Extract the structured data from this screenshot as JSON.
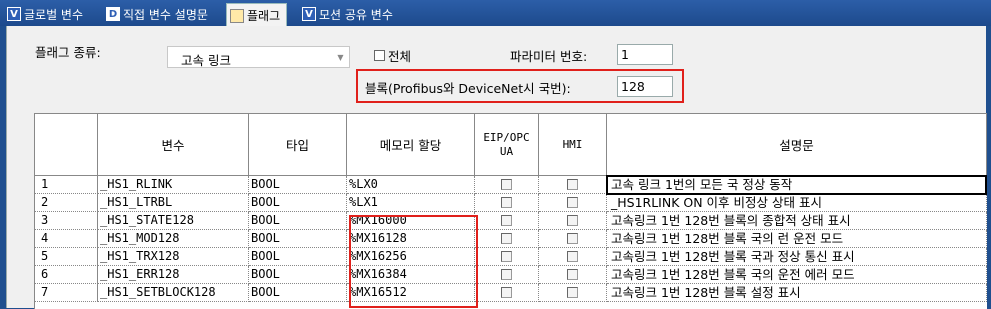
{
  "tabs": [
    {
      "icon": "V",
      "label": "글로벌 변수",
      "active": false
    },
    {
      "icon": "D",
      "label": "직접 변수 설명문",
      "active": false
    },
    {
      "icon": "F",
      "label": "플래그",
      "active": true
    },
    {
      "icon": "V",
      "label": "모션 공유 변수",
      "active": false
    }
  ],
  "filter": {
    "flag_type_label": "플래그 종류:",
    "flag_type_value": "고속 링크",
    "all_label": "전체",
    "param_label": "파라미터 번호:",
    "param_value": "1",
    "block_label": "블록(Profibus와 DeviceNet시 국번):",
    "block_value": "128"
  },
  "table": {
    "headers": [
      "변수",
      "타입",
      "메모리 할당",
      "EIP/OPC UA",
      "HMI",
      "설명문"
    ],
    "rows": [
      {
        "no": "1",
        "var": "_HS1_RLINK",
        "type": "BOOL",
        "mem": "%LX0",
        "desc": "고속 링크 1번의 모든 국 정상 동작"
      },
      {
        "no": "2",
        "var": "_HS1_LTRBL",
        "type": "BOOL",
        "mem": "%LX1",
        "desc": "_HS1RLINK ON 이후 비정상 상태 표시"
      },
      {
        "no": "3",
        "var": "_HS1_STATE128",
        "type": "BOOL",
        "mem": "%MX16000",
        "desc": "고속링크 1번 128번 블록의 종합적 상태 표시"
      },
      {
        "no": "4",
        "var": "_HS1_MOD128",
        "type": "BOOL",
        "mem": "%MX16128",
        "desc": "고속링크 1번 128번 블록 국의 런 운전 모드"
      },
      {
        "no": "5",
        "var": "_HS1_TRX128",
        "type": "BOOL",
        "mem": "%MX16256",
        "desc": "고속링크 1번 128번 블록 국과 정상 통신 표시"
      },
      {
        "no": "6",
        "var": "_HS1_ERR128",
        "type": "BOOL",
        "mem": "%MX16384",
        "desc": "고속링크 1번 128번 블록 국의 운전 에러 모드"
      },
      {
        "no": "7",
        "var": "_HS1_SETBLOCK128",
        "type": "BOOL",
        "mem": "%MX16512",
        "desc": "고속링크 1번 128번 블록 설정 표시"
      }
    ]
  },
  "colors": {
    "highlight": "#e0201b",
    "tabbar": "#1f4f8f"
  }
}
